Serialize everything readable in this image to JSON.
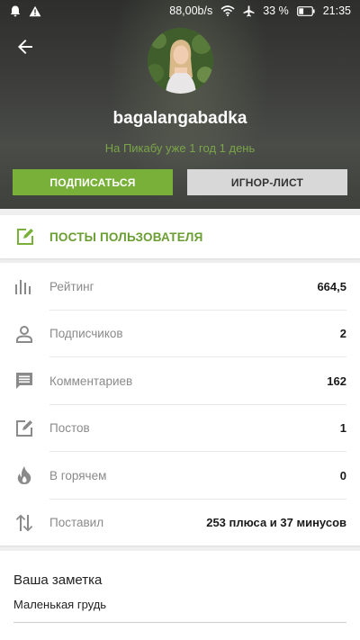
{
  "status_bar": {
    "speed": "88,00b/s",
    "battery": "33 %",
    "time": "21:35"
  },
  "profile": {
    "username": "bagalangabadka",
    "member_since": "На Пикабу уже 1 год 1 день",
    "subscribe_label": "ПОДПИСАТЬСЯ",
    "ignore_label": "ИГНОР-ЛИСТ"
  },
  "posts_link": {
    "label": "ПОСТЫ ПОЛЬЗОВАТЕЛЯ"
  },
  "stats": [
    {
      "icon": "chart-bars-icon",
      "name": "Рейтинг",
      "value": "664,5"
    },
    {
      "icon": "person-icon",
      "name": "Подписчиков",
      "value": "2"
    },
    {
      "icon": "comment-icon",
      "name": "Комментариев",
      "value": "162"
    },
    {
      "icon": "edit-icon",
      "name": "Постов",
      "value": "1"
    },
    {
      "icon": "fire-icon",
      "name": "В горячем",
      "value": "0"
    },
    {
      "icon": "swap-vertical-icon",
      "name": "Поставил",
      "value": "253 плюса и 37 минусов"
    }
  ],
  "note": {
    "title": "Ваша заметка",
    "text": "Маленькая грудь"
  },
  "colors": {
    "accent": "#78b039",
    "accent_text": "#6a9d32",
    "ignore_button": "#d8d8d8"
  }
}
